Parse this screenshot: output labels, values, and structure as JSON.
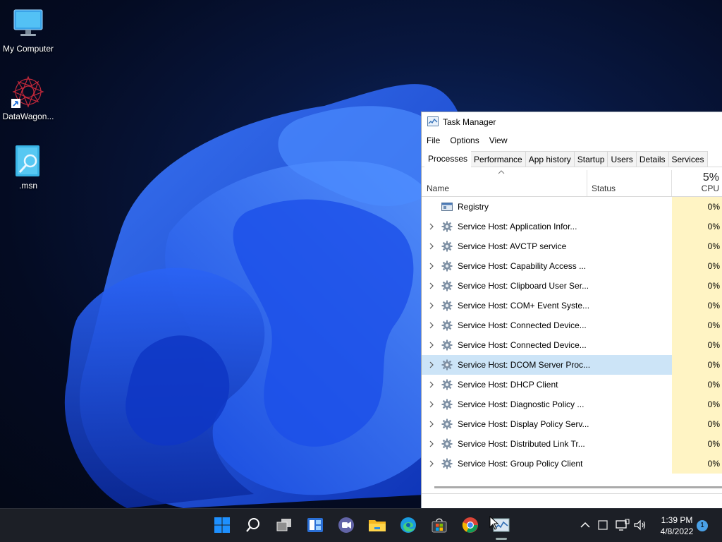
{
  "desktop": {
    "icons": [
      {
        "label": "My Computer",
        "icon": "monitor-icon"
      },
      {
        "label": "DataWagon...",
        "icon": "datawagon-app-icon"
      },
      {
        "label": ".msn",
        "icon": "msn-file-icon"
      }
    ]
  },
  "task_manager": {
    "title": "Task Manager",
    "menu": [
      "File",
      "Options",
      "View"
    ],
    "tabs": [
      "Processes",
      "Performance",
      "App history",
      "Startup",
      "Users",
      "Details",
      "Services"
    ],
    "active_tab": "Processes",
    "columns": {
      "name": "Name",
      "status": "Status",
      "cpu": "CPU",
      "cpu_total": "5%"
    },
    "rows": [
      {
        "name": "Registry",
        "cpu": "0%",
        "expandable": false,
        "icon": "registry-icon",
        "selected": false
      },
      {
        "name": "Service Host: Application Infor...",
        "cpu": "0%",
        "expandable": true,
        "icon": "gear-icon",
        "selected": false
      },
      {
        "name": "Service Host: AVCTP service",
        "cpu": "0%",
        "expandable": true,
        "icon": "gear-icon",
        "selected": false
      },
      {
        "name": "Service Host: Capability Access ...",
        "cpu": "0%",
        "expandable": true,
        "icon": "gear-icon",
        "selected": false
      },
      {
        "name": "Service Host: Clipboard User Ser...",
        "cpu": "0%",
        "expandable": true,
        "icon": "gear-icon",
        "selected": false
      },
      {
        "name": "Service Host: COM+ Event Syste...",
        "cpu": "0%",
        "expandable": true,
        "icon": "gear-icon",
        "selected": false
      },
      {
        "name": "Service Host: Connected Device...",
        "cpu": "0%",
        "expandable": true,
        "icon": "gear-icon",
        "selected": false
      },
      {
        "name": "Service Host: Connected Device...",
        "cpu": "0%",
        "expandable": true,
        "icon": "gear-icon",
        "selected": false
      },
      {
        "name": "Service Host: DCOM Server Proc...",
        "cpu": "0%",
        "expandable": true,
        "icon": "gear-icon",
        "selected": true
      },
      {
        "name": "Service Host: DHCP Client",
        "cpu": "0%",
        "expandable": true,
        "icon": "gear-icon",
        "selected": false
      },
      {
        "name": "Service Host: Diagnostic Policy ...",
        "cpu": "0%",
        "expandable": true,
        "icon": "gear-icon",
        "selected": false
      },
      {
        "name": "Service Host: Display Policy Serv...",
        "cpu": "0%",
        "expandable": true,
        "icon": "gear-icon",
        "selected": false
      },
      {
        "name": "Service Host: Distributed Link Tr...",
        "cpu": "0%",
        "expandable": true,
        "icon": "gear-icon",
        "selected": false
      },
      {
        "name": "Service Host: Group Policy Client",
        "cpu": "0%",
        "expandable": true,
        "icon": "gear-icon",
        "selected": false
      }
    ]
  },
  "taskbar": {
    "apps": [
      "start-icon",
      "search-icon",
      "task-view-icon",
      "widgets-icon",
      "teams-chat-icon",
      "file-explorer-icon",
      "edge-icon",
      "store-icon",
      "chrome-icon",
      "task-manager-icon"
    ],
    "tray": {
      "time": "1:39 PM",
      "date": "4/8/2022",
      "notifications": "1"
    }
  },
  "colors": {
    "selected_row": "#cce4f7",
    "cpu_column": "#fff4c4",
    "taskbar": "#1c1f26",
    "accent": "#1f6fd6"
  }
}
